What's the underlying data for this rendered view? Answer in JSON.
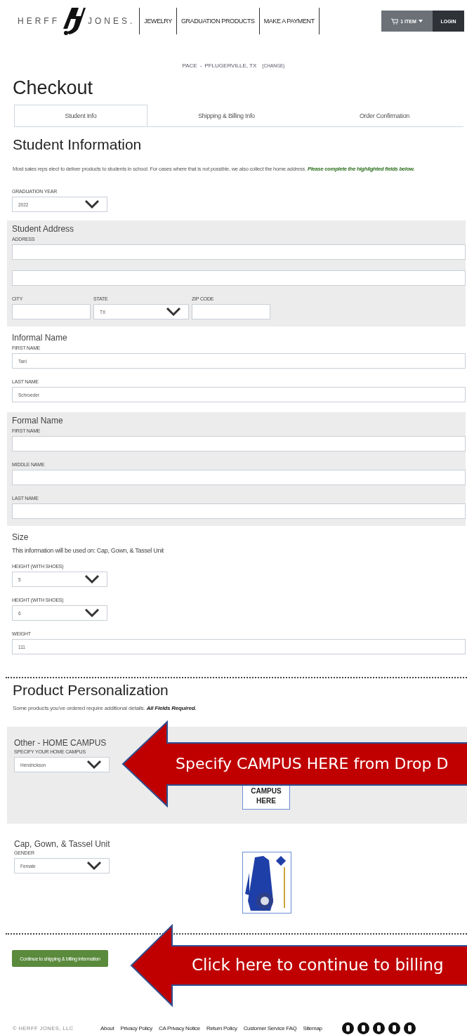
{
  "header": {
    "logo": {
      "left": "HERFF",
      "right": "JONES."
    },
    "nav": [
      "JEWELRY",
      "GRADUATION PRODUCTS",
      "MAKE A PAYMENT"
    ],
    "cart": "1 ITEM",
    "login": "LOGIN"
  },
  "location": {
    "school": "PACE",
    "separator": "-",
    "city": "PFLUGERVILLE, TX",
    "change": "(CHANGE)"
  },
  "title": "Checkout",
  "tabs": [
    {
      "label": "Student Info",
      "selected": true
    },
    {
      "label": "Shipping & Billing Info",
      "selected": false
    },
    {
      "label": "Order Confirmation",
      "selected": false
    }
  ],
  "student_info": {
    "heading": "Student Information",
    "intro": "Most sales reps elect to deliver products to students in school. For cases where that is not possible, we also collect the home address. **Please complete the highlighted fields below.**",
    "graduation_year": {
      "label": "GRADUATION YEAR",
      "value": "2022"
    }
  },
  "sections": [
    {
      "title": "Student Address",
      "shaded": true,
      "rows": [
        [
          {
            "kind": "text",
            "label": "ADDRESS"
          }
        ],
        [
          {
            "kind": "text"
          }
        ],
        [
          {
            "kind": "text",
            "label": "CITY"
          },
          {
            "kind": "select",
            "label": "STATE",
            "value": "TX"
          },
          {
            "kind": "text",
            "label": "ZIP CODE"
          }
        ]
      ]
    },
    {
      "title": "Informal Name",
      "shaded": false,
      "rows": [
        [
          {
            "kind": "text",
            "label": "FIRST NAME",
            "value": "Tani"
          }
        ],
        [
          {
            "kind": "text",
            "label": "LAST NAME",
            "value": "Schroeder"
          }
        ]
      ]
    },
    {
      "title": "Formal Name",
      "shaded": true,
      "rows": [
        [
          {
            "kind": "text",
            "label": "FIRST NAME"
          }
        ],
        [
          {
            "kind": "text",
            "label": "MIDDLE NAME"
          }
        ],
        [
          {
            "kind": "text",
            "label": "LAST NAME"
          }
        ]
      ]
    },
    {
      "title": "Size",
      "shaded": false,
      "note": "This information will be used on: Cap, Gown, & Tassel Unit",
      "rows": [
        [
          {
            "kind": "select",
            "label": "HEIGHT (WITH SHOES)",
            "value": "5"
          }
        ],
        [
          {
            "kind": "select",
            "label": "HEIGHT (WITH SHOES)",
            "value": "6"
          }
        ],
        [
          {
            "kind": "text",
            "label": "WEIGHT",
            "value": "111"
          }
        ]
      ]
    }
  ],
  "personalization": {
    "heading": "Product Personalization",
    "intro": "Some products you've ordered require additional details. **All Fields Required.**",
    "products": [
      {
        "title": "Other - HOME CAMPUS",
        "shaded": true,
        "field": {
          "label": "SPECIFY YOUR HOME CAMPUS",
          "value": "Hendrickson"
        },
        "image": {
          "kind": "campus",
          "lines": [
            "CAMPUS",
            "HERE"
          ]
        }
      },
      {
        "title": "Cap, Gown, & Tassel Unit",
        "shaded": false,
        "field": {
          "label": "GENDER",
          "value": "Female"
        },
        "image": {
          "kind": "gown"
        }
      }
    ]
  },
  "continue_button": "Continue to shipping & billing information",
  "footer": {
    "copyright": "© HERFF JONES, LLC",
    "links": [
      "About",
      "Privacy Policy",
      "CA Privacy Notice",
      "Return Policy",
      "Customer Service FAQ",
      "Sitemap"
    ]
  },
  "annotations": [
    {
      "text": "Specify CAMPUS HERE from Drop D"
    },
    {
      "text": "Click here to continue to billing"
    }
  ]
}
